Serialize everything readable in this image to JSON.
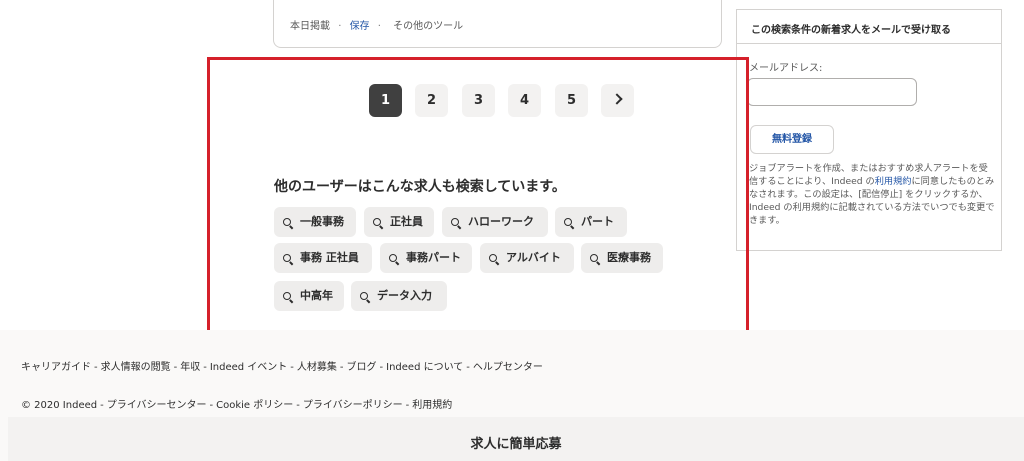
{
  "job_card": {
    "posted": "本日掲載",
    "save_label": "保存",
    "other_tools": "その他のツール"
  },
  "pagination": {
    "pages": [
      "1",
      "2",
      "3",
      "4",
      "5"
    ],
    "current": "1"
  },
  "related": {
    "title": "他のユーザーはこんな求人も検索しています。",
    "searches": [
      "一般事務",
      "正社員",
      "ハローワーク",
      "パート",
      "事務 正社員",
      "事務パート",
      "アルバイト",
      "医療事務",
      "中高年",
      "データ入力"
    ]
  },
  "alert_panel": {
    "title": "この検索条件の新着求人をメールで受け取る",
    "email_label": "メールアドレス:",
    "email_value": "",
    "submit_label": "無料登録",
    "desc_1": "ジョブアラートを作成、またはおすすめ求人アラートを受信することにより、Indeed の",
    "terms_link": "利用規約",
    "desc_2": "に同意したものとみなされます。この設定は、[配信停止] をクリックするか、Indeed の利用規約に記載されている方法でいつでも変更できます。"
  },
  "footer": {
    "links": [
      "キャリアガイド",
      "求人情報の閲覧",
      "年収",
      "Indeed イベント",
      "人材募集",
      "ブログ",
      "Indeed について",
      "ヘルプセンター"
    ],
    "legal": [
      "© 2020 Indeed",
      "プライバシーセンター",
      "Cookie ポリシー",
      "プライバシーポリシー",
      "利用規約"
    ]
  },
  "apply_bar": {
    "title": "求人に簡単応募"
  },
  "colors": {
    "highlight": "#d5202a",
    "link": "#2557a7",
    "active_page": "#404040"
  }
}
